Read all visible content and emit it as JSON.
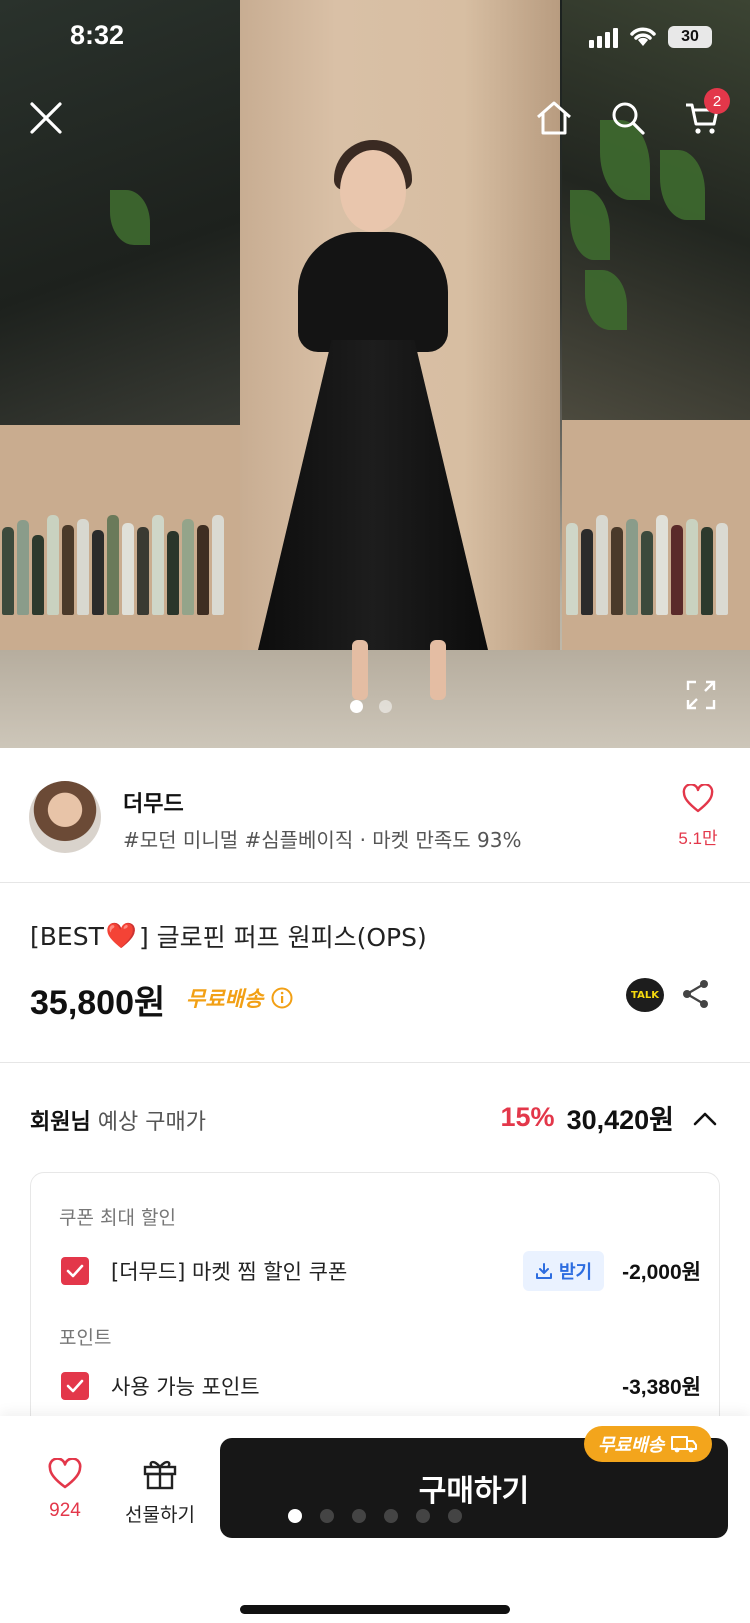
{
  "status": {
    "time": "8:32",
    "battery": "30"
  },
  "top_nav": {
    "cart_count": "2"
  },
  "hero": {
    "slide_count": 2,
    "active_slide": 1
  },
  "seller": {
    "name": "더무드",
    "tags": "#모던 미니멀 #심플베이직 · 마켓 만족도 93%",
    "likes": "5.1만"
  },
  "product": {
    "title_prefix": "[BEST",
    "title_emoji": "❤️",
    "title_suffix": "] 글로핀 퍼프 원피스(OPS)",
    "price": "35,800원",
    "shipping": "무료배송",
    "talk_label": "TALK"
  },
  "member_price": {
    "label_bold": "회원님",
    "label": "예상 구매가",
    "discount": "15%",
    "price": "30,420원"
  },
  "benefits": {
    "coupon_section": "쿠폰 최대 할인",
    "coupon_label": "[더무드] 마켓 찜 할인 쿠폰",
    "coupon_button": "받기",
    "coupon_amount": "-2,000원",
    "point_section": "포인트",
    "point_label": "사용 가능 포인트",
    "point_amount": "-3,380원"
  },
  "bottom_bar": {
    "like_count": "924",
    "gift_label": "선물하기",
    "buy_label": "구매하기",
    "buy_badge": "무료배송",
    "page_count": 6,
    "active_page": 1
  },
  "colors": {
    "accent": "#e3374a",
    "shipping": "#f2a015",
    "buy": "#171717",
    "link": "#2d6de0"
  }
}
